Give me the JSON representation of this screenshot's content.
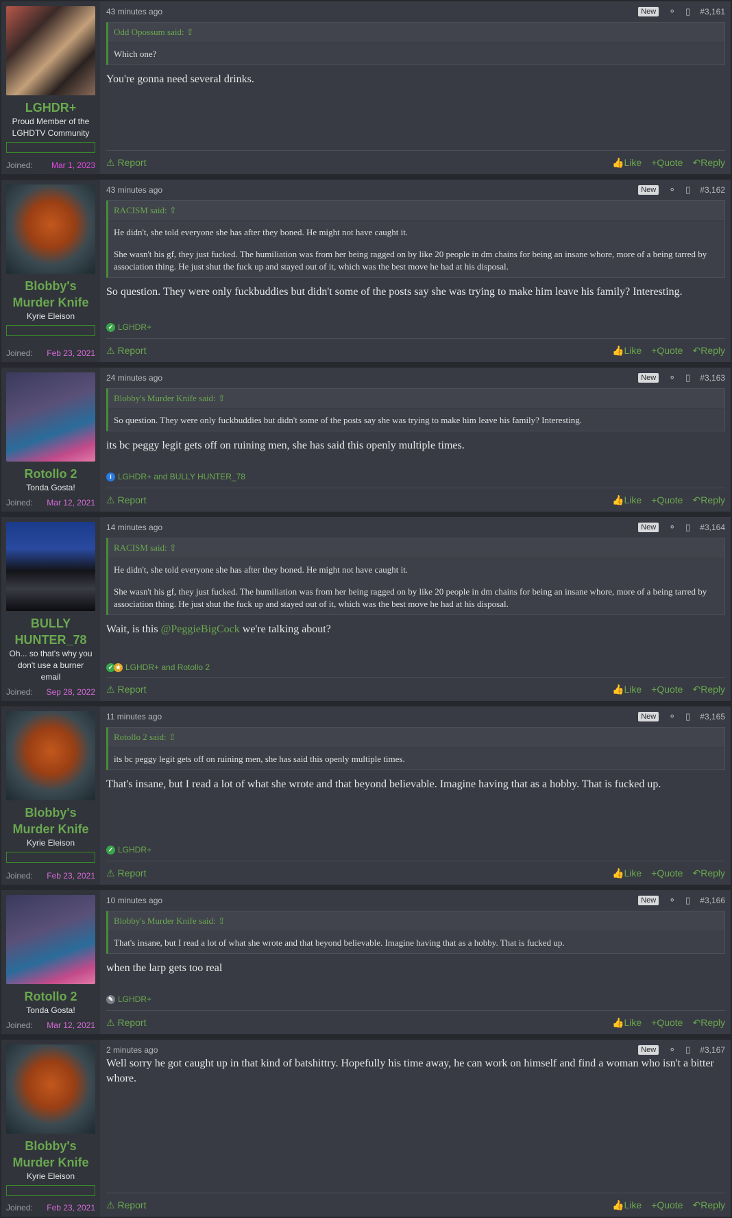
{
  "labels": {
    "new": "New",
    "joined": "Joined:",
    "report": "Report",
    "like": "Like",
    "quote": "Quote",
    "reply": "Reply"
  },
  "posts": [
    {
      "time": "43 minutes ago",
      "number": "#3,161",
      "user": {
        "name": "LGHDR+",
        "title": "Proud Member of the LGHDTV Community",
        "joined": "Mar 1, 2023"
      },
      "quote": {
        "author": "Odd Opossum said:",
        "paras": [
          "Which one?"
        ]
      },
      "body": "You're gonna need several drinks."
    },
    {
      "time": "43 minutes ago",
      "number": "#3,162",
      "user": {
        "name": "Blobby's Murder Knife",
        "title": "Kyrie Eleison",
        "joined": "Feb 23, 2021"
      },
      "quote": {
        "author": "RACISM said:",
        "paras": [
          "He didn't, she told everyone she has after they boned. He might not have caught it.",
          "She wasn't his gf, they just fucked. The humiliation was from her being ragged on by like 20 people in dm chains for being an insane whore, more of a being tarred by association thing. He just shut the fuck up and stayed out of it, which was the best move he had at his disposal."
        ]
      },
      "body": "So question. They were only fuckbuddies but didn't some of the posts say she was trying to make him leave his family? Interesting.",
      "reactions": "LGHDR+"
    },
    {
      "time": "24 minutes ago",
      "number": "#3,163",
      "user": {
        "name": "Rotollo 2",
        "title": "Tonda Gosta!",
        "joined": "Mar 12, 2021"
      },
      "quote": {
        "author": "Blobby's Murder Knife said:",
        "paras": [
          "So question. They were only fuckbuddies but didn't some of the posts say she was trying to make him leave his family? Interesting."
        ]
      },
      "body": "its bc peggy legit gets off on ruining men, she has said this openly multiple times.",
      "reactions": "LGHDR+ and BULLY HUNTER_78"
    },
    {
      "time": "14 minutes ago",
      "number": "#3,164",
      "user": {
        "name": "BULLY HUNTER_78",
        "title": "Oh... so that's why you don't use a burner email",
        "joined": "Sep 28, 2022"
      },
      "quote": {
        "author": "RACISM said:",
        "paras": [
          "He didn't, she told everyone she has after they boned. He might not have caught it.",
          "She wasn't his gf, they just fucked. The humiliation was from her being ragged on by like 20 people in dm chains for being an insane whore, more of a being tarred by association thing. He just shut the fuck up and stayed out of it, which was the best move he had at his disposal."
        ]
      },
      "body_pre": "Wait, is this ",
      "mention": "@PeggieBigCock",
      "body_post": " we're talking about?",
      "reactions": "LGHDR+ and Rotollo 2"
    },
    {
      "time": "11 minutes ago",
      "number": "#3,165",
      "user": {
        "name": "Blobby's Murder Knife",
        "title": "Kyrie Eleison",
        "joined": "Feb 23, 2021"
      },
      "quote": {
        "author": "Rotollo 2 said:",
        "paras": [
          "its bc peggy legit gets off on ruining men, she has said this openly multiple times."
        ]
      },
      "body": "That's insane, but I read a lot of what she wrote and that beyond believable. Imagine having that as a hobby. That is fucked up.",
      "reactions": "LGHDR+"
    },
    {
      "time": "10 minutes ago",
      "number": "#3,166",
      "user": {
        "name": "Rotollo 2",
        "title": "Tonda Gosta!",
        "joined": "Mar 12, 2021"
      },
      "quote": {
        "author": "Blobby's Murder Knife said:",
        "paras": [
          "That's insane, but I read a lot of what she wrote and that beyond believable. Imagine having that as a hobby. That is fucked up."
        ]
      },
      "body": "when the larp gets too real",
      "reactions": "LGHDR+"
    },
    {
      "time": "2 minutes ago",
      "number": "#3,167",
      "user": {
        "name": "Blobby's Murder Knife",
        "title": "Kyrie Eleison",
        "joined": "Feb 23, 2021"
      },
      "body": "Well sorry he got caught up in that kind of batshittry. Hopefully his time away, he can work on himself and find a woman who isn't a bitter whore."
    }
  ]
}
